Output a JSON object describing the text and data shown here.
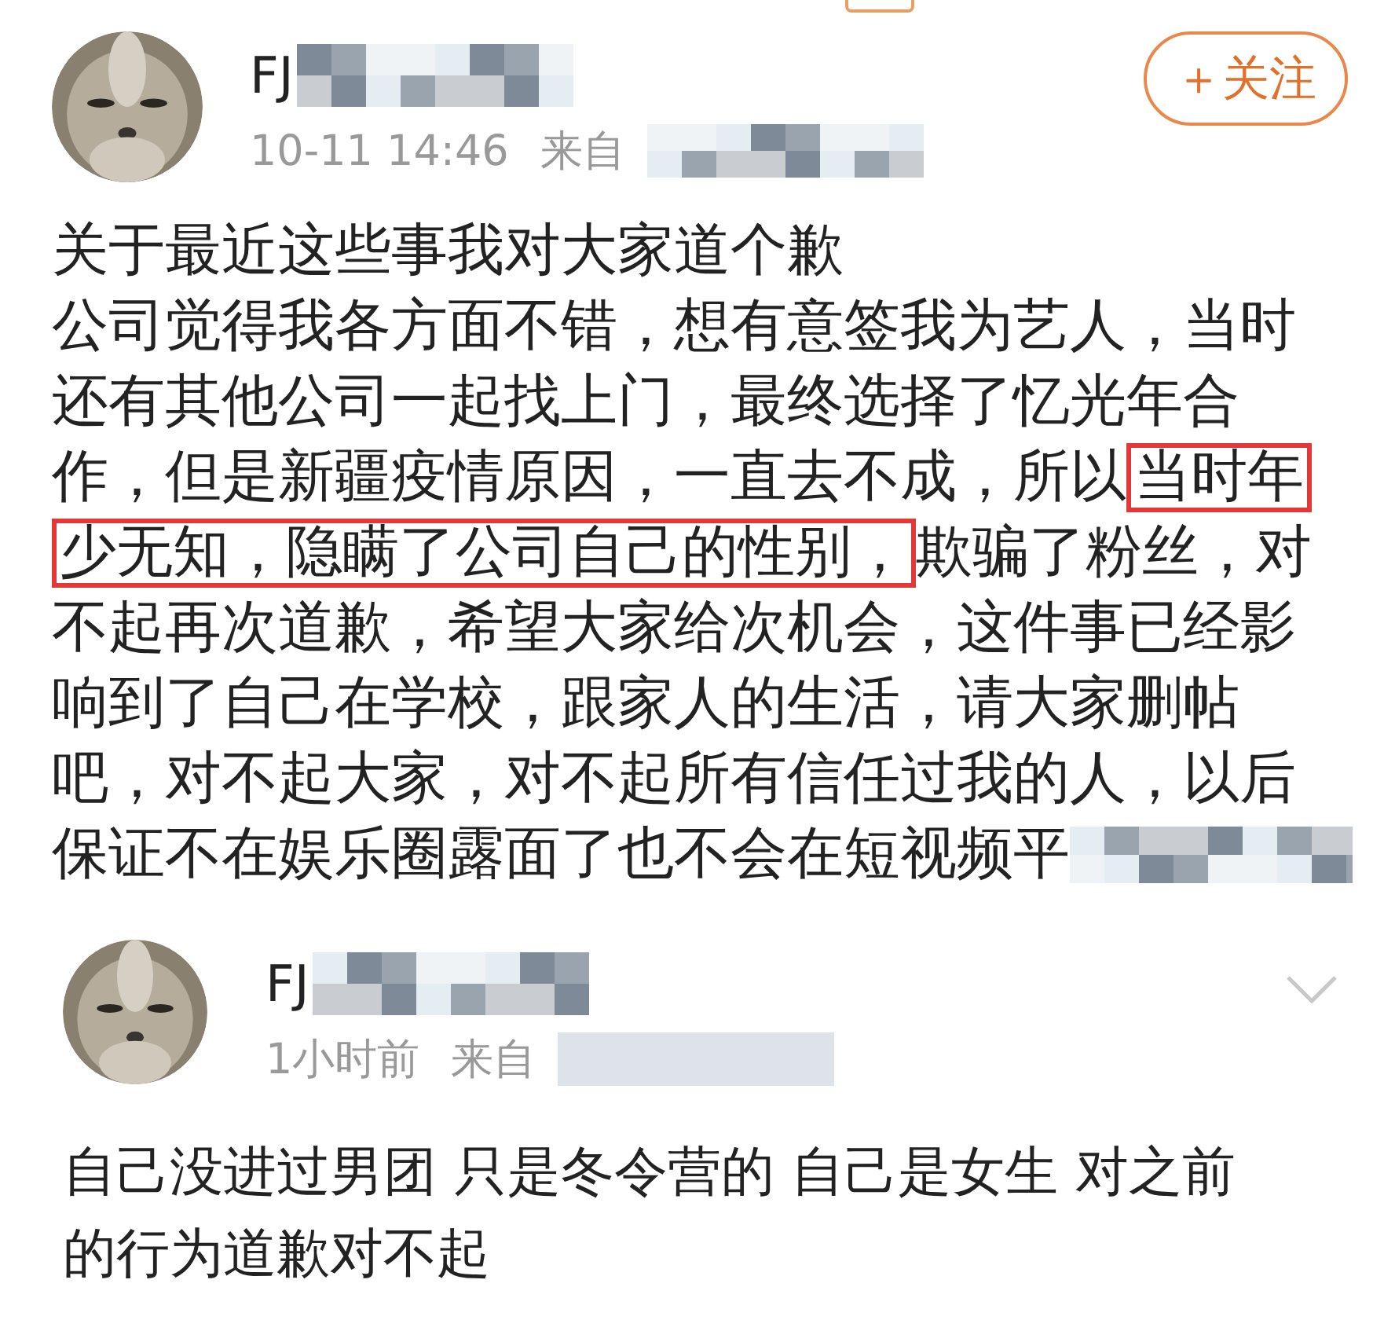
{
  "posts": [
    {
      "author": "FJ",
      "time": "10-11 14:46",
      "source_label": "来自",
      "action": {
        "kind": "follow",
        "label": "＋关注"
      },
      "body_lines": [
        [
          {
            "text": "关于最近这些事我对大家道个歉",
            "boxed": false
          }
        ],
        [
          {
            "text": "公司觉得我各方面不错，想有意签我为艺人，当时",
            "boxed": false
          }
        ],
        [
          {
            "text": "还有其他公司一起找上门，最终选择了忆光年合",
            "boxed": false
          }
        ],
        [
          {
            "text": "作，但是新疆疫情原因，一直去不成，所以",
            "boxed": false
          },
          {
            "text": "当时年",
            "boxed": true
          }
        ],
        [
          {
            "text": "少无知，隐瞒了公司自己的性别，",
            "boxed": true
          },
          {
            "text": "欺骗了粉丝，对",
            "boxed": false
          }
        ],
        [
          {
            "text": "不起再次道歉，希望大家给次机会，这件事已经影",
            "boxed": false
          }
        ],
        [
          {
            "text": "响到了自己在学校，跟家人的生活，请大家删帖",
            "boxed": false
          }
        ],
        [
          {
            "text": "吧，对不起大家，对不起所有信任过我的人，以后",
            "boxed": false
          }
        ],
        [
          {
            "text": "保证不在娱乐圈露面了也不会在短视频平",
            "boxed": false
          }
        ]
      ],
      "body_cut": true
    },
    {
      "author": "FJ",
      "time": "1小时前",
      "source_label": "来自",
      "action": {
        "kind": "chevron"
      },
      "body_lines": [
        [
          {
            "text": "自己没进过男团 只是冬令营的 自己是女生 对之前",
            "boxed": false
          }
        ],
        [
          {
            "text": "的行为道歉对不起",
            "boxed": false
          }
        ]
      ],
      "body_cut": false
    }
  ]
}
